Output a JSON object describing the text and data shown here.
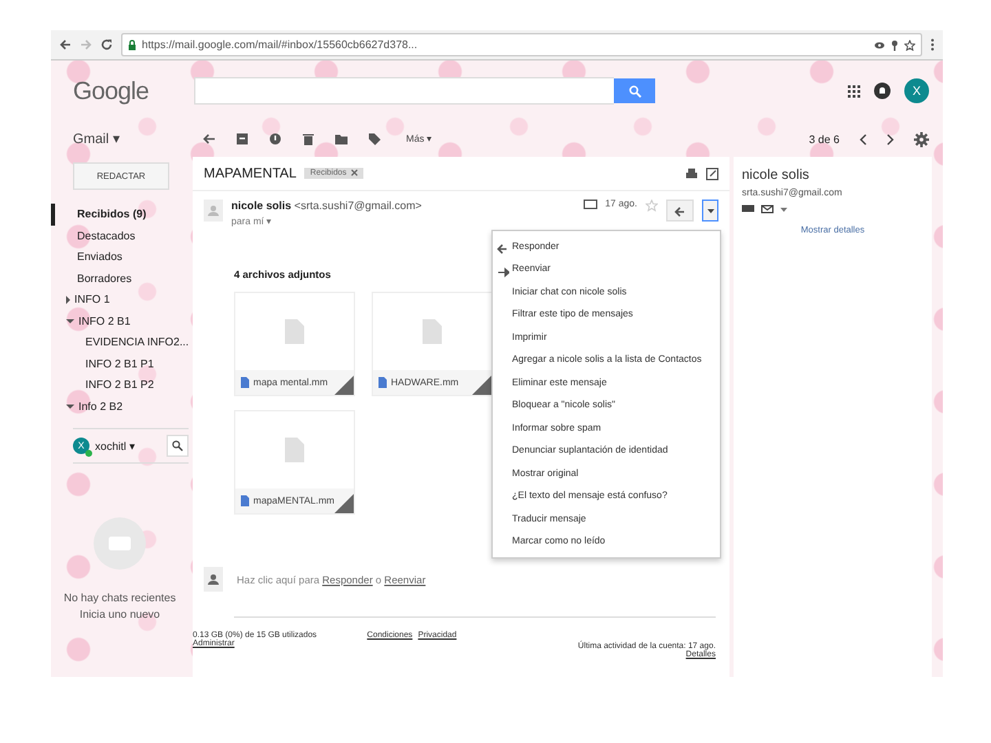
{
  "browser": {
    "url": "https://mail.google.com/mail/#inbox/15560cb6627d378..."
  },
  "header": {
    "logo": "Google",
    "avatar": "X"
  },
  "toolbar": {
    "app_menu": "Gmail ▾",
    "more": "Más ▾",
    "pager": "3 de 6"
  },
  "sidebar": {
    "compose": "REDACTAR",
    "labels": [
      {
        "text": "Recibidos (9)",
        "selected": true
      },
      {
        "text": "Destacados",
        "selected": false
      },
      {
        "text": "Enviados",
        "selected": false
      },
      {
        "text": "Borradores",
        "selected": false
      },
      {
        "text": "INFO 1",
        "selected": false,
        "expanded": false
      },
      {
        "text": "INFO 2 B1",
        "selected": false,
        "expanded": true,
        "children": [
          {
            "text": "EVIDENCIA INFO2...",
            "selected": false
          },
          {
            "text": "INFO 2 B1 P1",
            "selected": false
          },
          {
            "text": "INFO 2 B1 P2",
            "selected": false
          }
        ]
      },
      {
        "text": "Info 2 B2",
        "selected": false,
        "expanded": true
      }
    ]
  },
  "chat": {
    "user": "xochitl ▾",
    "avatar": "X",
    "online": true,
    "empty_lines": [
      "No hay chats recientes",
      "Inicia uno nuevo"
    ]
  },
  "message": {
    "subject": "MAPAMENTAL",
    "label": "Recibidos",
    "sender_name": "nicole solis",
    "sender_email": "<srta.sushi7@gmail.com>",
    "to": "para mí ▾",
    "date": "17 ago.",
    "starred": false,
    "attachments_title": "4 archivos adjuntos",
    "attachments": [
      {
        "name": "mapa mental.mm"
      },
      {
        "name": "HADWARE.mm"
      },
      {
        "name": "mapaMENTAL.mm"
      }
    ],
    "reply": {
      "prefix": "Haz clic aquí para ",
      "reply_link": "Responder",
      "joiner": " o ",
      "forward_link": "Reenviar"
    }
  },
  "menu": [
    {
      "text": "Responder",
      "kind": "reply"
    },
    {
      "text": "Reenviar",
      "kind": "forward"
    },
    {
      "text": "Iniciar chat con nicole solis",
      "kind": "plain"
    },
    {
      "text": "Filtrar este tipo de mensajes",
      "kind": "plain"
    },
    {
      "text": "Imprimir",
      "kind": "plain"
    },
    {
      "text": "Agregar a nicole solis a la lista de Contactos",
      "kind": "plain"
    },
    {
      "text": "Eliminar este mensaje",
      "kind": "plain"
    },
    {
      "text": "Bloquear a \"nicole solis\"",
      "kind": "plain"
    },
    {
      "text": "Informar sobre spam",
      "kind": "plain"
    },
    {
      "text": "Denunciar suplantación de identidad",
      "kind": "plain"
    },
    {
      "text": "Mostrar original",
      "kind": "plain"
    },
    {
      "text": "¿El texto del mensaje está confuso?",
      "kind": "plain"
    },
    {
      "text": "Traducir mensaje",
      "kind": "plain"
    },
    {
      "text": "Marcar como no leído",
      "kind": "plain"
    }
  ],
  "footer": {
    "storage": "0.13 GB (0%) de 15 GB utilizados",
    "manage": "Administrar",
    "links": [
      "Condiciones",
      "Privacidad"
    ],
    "activity": "Última actividad de la cuenta: 17 ago.",
    "details": "Detalles"
  },
  "contact": {
    "name": "nicole solis",
    "email": "srta.sushi7@gmail.com",
    "details": "Mostrar detalles"
  }
}
